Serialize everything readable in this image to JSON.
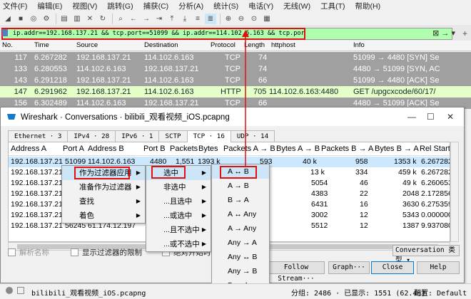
{
  "menu": [
    "文件(F)",
    "编辑(E)",
    "视图(V)",
    "跳转(G)",
    "捕获(C)",
    "分析(A)",
    "统计(S)",
    "电话(Y)",
    "无线(W)",
    "工具(T)",
    "帮助(H)"
  ],
  "filter": {
    "text": "ip.addr==192.168.137.21 && tcp.port==51099 && ip.addr==114.102.6.163 && tcp.port==4480"
  },
  "packet_columns": [
    "No.",
    "Time",
    "Source",
    "Destination",
    "Protocol",
    "Length",
    "httphost",
    "Info"
  ],
  "packets": [
    {
      "no": "117",
      "time": "6.267282",
      "src": "192.168.137.21",
      "dst": "114.102.6.163",
      "proto": "TCP",
      "len": "74",
      "host": "",
      "info": "51099 → 4480 [SYN] Se"
    },
    {
      "no": "133",
      "time": "6.280553",
      "src": "114.102.6.163",
      "dst": "192.168.137.21",
      "proto": "TCP",
      "len": "74",
      "host": "",
      "info": "4480 → 51099 [SYN, AC"
    },
    {
      "no": "143",
      "time": "6.291218",
      "src": "192.168.137.21",
      "dst": "114.102.6.163",
      "proto": "TCP",
      "len": "66",
      "host": "",
      "info": "51099 → 4480 [ACK] Se"
    },
    {
      "no": "147",
      "time": "6.291962",
      "src": "192.168.137.21",
      "dst": "114.102.6.163",
      "proto": "HTTP",
      "len": "705",
      "host": "114.102.6.163:4480",
      "info": "GET /upgcxcode/60/17/"
    },
    {
      "no": "156",
      "time": "6.302489",
      "src": "114.102.6.163",
      "dst": "192.168.137.21",
      "proto": "TCP",
      "len": "66",
      "host": "",
      "info": "4480 → 51099 [ACK] Se"
    }
  ],
  "dialog": {
    "title": "Wireshark · Conversations · bilibili_观看视频_iOS.pcapng",
    "tabs": [
      "Ethernet · 3",
      "IPv4 · 28",
      "IPv6 · 1",
      "SCTP",
      "TCP · 16",
      "UDP · 14"
    ],
    "columns": [
      "Address A",
      "Port A",
      "Address B",
      "Port B",
      "Packets",
      "Bytes",
      "Packets A → B",
      "Bytes A → B",
      "Packets B → A",
      "Bytes B → A",
      "Rel Start"
    ],
    "rows": [
      {
        "a": "192.168.137.21",
        "pa": "51099",
        "b": "114.102.6.163",
        "pb": "4480",
        "pk": "1,551",
        "by": "1393 k",
        "pab": "593",
        "bab": "40 k",
        "pba": "958",
        "bba": "1353 k",
        "rel": "6.267282"
      },
      {
        "a": "192.168.137.21",
        "pa": "",
        "b": "",
        "pb": "",
        "pk": "",
        "by": "",
        "pab": "",
        "bab": "13 k",
        "pba": "334",
        "bba": "459 k",
        "rel": "6.267282"
      },
      {
        "a": "192.168.137.21",
        "pa": "",
        "b": "",
        "pb": "",
        "pk": "",
        "by": "",
        "pab": "",
        "bab": "5054",
        "pba": "46",
        "bba": "49 k",
        "rel": "6.260653"
      },
      {
        "a": "192.168.137.21",
        "pa": "",
        "b": "",
        "pb": "",
        "pk": "",
        "by": "",
        "pab": "",
        "bab": "4383",
        "pba": "22",
        "bba": "2048",
        "rel": "2.172856"
      },
      {
        "a": "192.168.137.21",
        "pa": "",
        "b": "",
        "pb": "",
        "pk": "",
        "by": "",
        "pab": "",
        "bab": "6431",
        "pba": "16",
        "bba": "3630",
        "rel": "6.275359"
      },
      {
        "a": "192.168.137.21",
        "pa": "",
        "b": "",
        "pb": "",
        "pk": "",
        "by": "",
        "pab": "",
        "bab": "3002",
        "pba": "12",
        "bba": "5343",
        "rel": "0.000000"
      },
      {
        "a": "192.168.137.21",
        "pa": "56245",
        "b": "61.174.12.197",
        "pb": "",
        "pk": "",
        "by": "",
        "pab": "",
        "bab": "5512",
        "pba": "12",
        "bba": "1387",
        "rel": "9.937080"
      }
    ],
    "name_resolution": "解析名称",
    "limit_to_filter": "显示过滤器的限制",
    "absolute_start": "绝对开始时间",
    "follow_stream": "Follow Stream···",
    "graph": "Graph···",
    "close": "Close",
    "help": "Help",
    "conversation_type": "Conversation 类型"
  },
  "context_menu": {
    "items": [
      "作为过滤器应用",
      "准备作为过滤器",
      "查找",
      "着色"
    ],
    "sub1": [
      "选中",
      "非选中",
      "...且选中",
      "...或选中",
      "...且不选中",
      "...或不选中"
    ],
    "sub2": [
      "A ↔ B",
      "A → B",
      "B → A",
      "A ↔ Any",
      "A → Any",
      "Any → A",
      "Any ↔ B",
      "Any → B",
      "B → Any"
    ]
  },
  "status": {
    "file": "bilibili_观看视频_iOS.pcapng",
    "counts": "分组: 2486 · 已显示: 1551 (62.4%)",
    "profile": "配置: Default"
  }
}
